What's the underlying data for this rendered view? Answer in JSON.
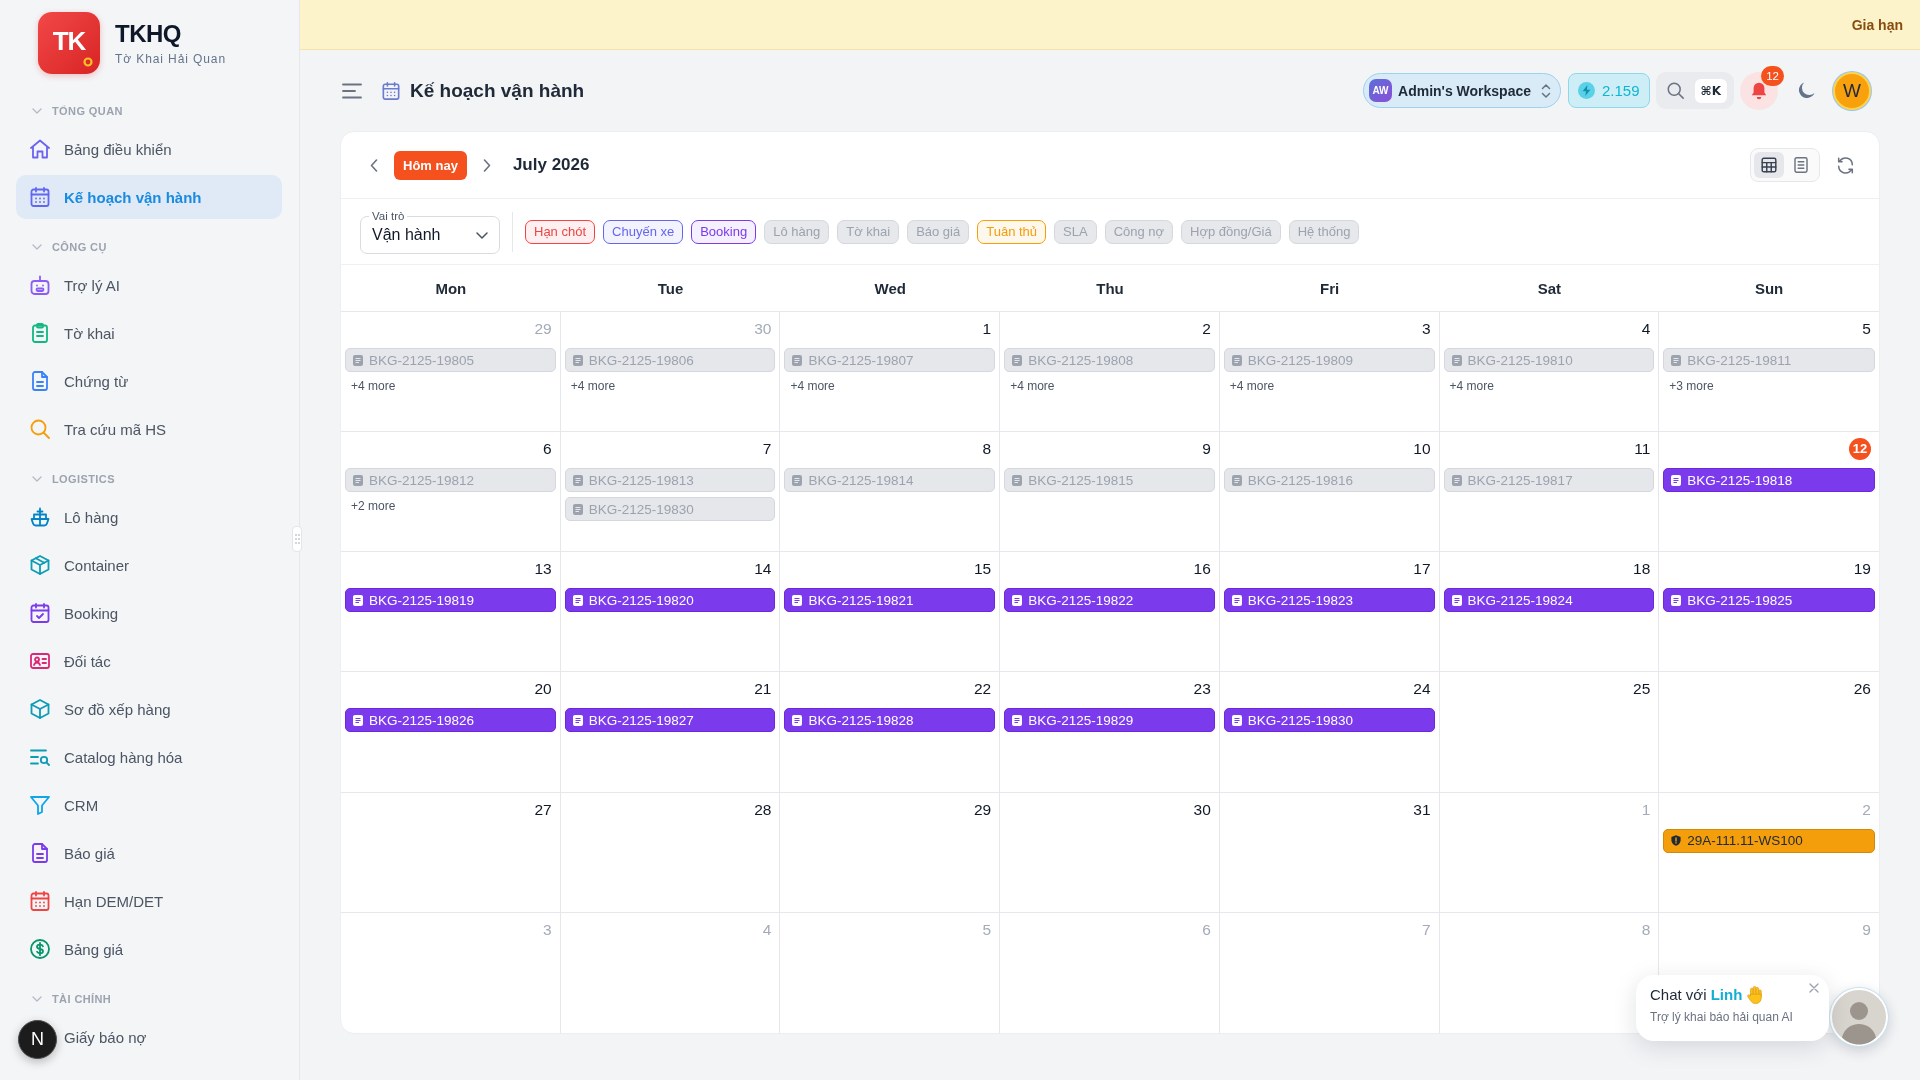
{
  "sidebar": {
    "logo": {
      "mark": "TK",
      "title": "TKHQ",
      "subtitle": "Tờ Khai Hải Quan"
    },
    "sections": [
      {
        "title": "TỔNG QUAN",
        "expanded": true,
        "items": [
          {
            "label": "Bảng điều khiển",
            "selected": false
          },
          {
            "label": "Kế hoạch vận hành",
            "selected": true
          }
        ]
      },
      {
        "title": "CÔNG CỤ",
        "expanded": true,
        "items": [
          {
            "label": "Trợ lý AI",
            "selected": false
          },
          {
            "label": "Tờ khai",
            "selected": false
          },
          {
            "label": "Chứng từ",
            "selected": false
          },
          {
            "label": "Tra cứu mã HS",
            "selected": false
          }
        ]
      },
      {
        "title": "LOGISTICS",
        "expanded": true,
        "items": [
          {
            "label": "Lô hàng",
            "selected": false
          },
          {
            "label": "Container",
            "selected": false
          },
          {
            "label": "Booking",
            "selected": false
          },
          {
            "label": "Đối tác",
            "selected": false
          },
          {
            "label": "Sơ đồ xếp hàng",
            "selected": false
          },
          {
            "label": "Catalog hàng hóa",
            "selected": false
          },
          {
            "label": "CRM",
            "selected": false
          },
          {
            "label": "Báo giá",
            "selected": false
          },
          {
            "label": "Hạn DEM/DET",
            "selected": false
          },
          {
            "label": "Bảng giá",
            "selected": false
          }
        ]
      },
      {
        "title": "TÀI CHÍNH",
        "expanded": true,
        "items": [
          {
            "label": "Giấy báo nợ",
            "selected": false
          }
        ]
      }
    ]
  },
  "banner": {
    "action": "Gia hạn"
  },
  "header": {
    "title": "Kế hoạch vận hành",
    "workspace": {
      "initials": "AW",
      "name": "Admin's Workspace"
    },
    "credits": "2.159",
    "search_shortcut": "⌘K",
    "notification_count": "12",
    "user_initial": "W"
  },
  "calendar": {
    "today_button": "Hôm nay",
    "month": "July 2026",
    "views": [
      {
        "kind": "month",
        "selected": true
      },
      {
        "kind": "list",
        "selected": false
      }
    ],
    "role": {
      "label": "Vai trò",
      "value": "Vận hành"
    },
    "filters": [
      {
        "label": "Hạn chót",
        "selected": true,
        "color": "#ef4444"
      },
      {
        "label": "Chuyến xe",
        "selected": true,
        "color": "#6366f1"
      },
      {
        "label": "Booking",
        "selected": true,
        "color": "#7c3aed"
      },
      {
        "label": "Lô hàng",
        "selected": false
      },
      {
        "label": "Tờ khai",
        "selected": false
      },
      {
        "label": "Báo giá",
        "selected": false
      },
      {
        "label": "Tuân thủ",
        "selected": true,
        "color": "#f59e0b"
      },
      {
        "label": "SLA",
        "selected": false
      },
      {
        "label": "Công nợ",
        "selected": false
      },
      {
        "label": "Hợp đồng/Giá",
        "selected": false
      },
      {
        "label": "Hệ thống",
        "selected": false
      }
    ],
    "weekdays": [
      "Mon",
      "Tue",
      "Wed",
      "Thu",
      "Fri",
      "Sat",
      "Sun"
    ],
    "weeks": [
      {
        "days": [
          {
            "date": "29",
            "outside": true,
            "today": false,
            "events": [
              {
                "label": "BKG-2125-19805",
                "kind": "booking",
                "past": true
              }
            ],
            "more": "+4 more"
          },
          {
            "date": "30",
            "outside": true,
            "today": false,
            "events": [
              {
                "label": "BKG-2125-19806",
                "kind": "booking",
                "past": true
              }
            ],
            "more": "+4 more"
          },
          {
            "date": "1",
            "outside": false,
            "today": false,
            "events": [
              {
                "label": "BKG-2125-19807",
                "kind": "booking",
                "past": true
              }
            ],
            "more": "+4 more"
          },
          {
            "date": "2",
            "outside": false,
            "today": false,
            "events": [
              {
                "label": "BKG-2125-19808",
                "kind": "booking",
                "past": true
              }
            ],
            "more": "+4 more"
          },
          {
            "date": "3",
            "outside": false,
            "today": false,
            "events": [
              {
                "label": "BKG-2125-19809",
                "kind": "booking",
                "past": true
              }
            ],
            "more": "+4 more"
          },
          {
            "date": "4",
            "outside": false,
            "today": false,
            "events": [
              {
                "label": "BKG-2125-19810",
                "kind": "booking",
                "past": true
              }
            ],
            "more": "+4 more"
          },
          {
            "date": "5",
            "outside": false,
            "today": false,
            "events": [
              {
                "label": "BKG-2125-19811",
                "kind": "booking",
                "past": true
              }
            ],
            "more": "+3 more"
          }
        ]
      },
      {
        "days": [
          {
            "date": "6",
            "outside": false,
            "today": false,
            "events": [
              {
                "label": "BKG-2125-19812",
                "kind": "booking",
                "past": true
              }
            ],
            "more": "+2 more"
          },
          {
            "date": "7",
            "outside": false,
            "today": false,
            "events": [
              {
                "label": "BKG-2125-19813",
                "kind": "booking",
                "past": true
              },
              {
                "label": "BKG-2125-19830",
                "kind": "booking",
                "past": true
              }
            ]
          },
          {
            "date": "8",
            "outside": false,
            "today": false,
            "events": [
              {
                "label": "BKG-2125-19814",
                "kind": "booking",
                "past": true
              }
            ]
          },
          {
            "date": "9",
            "outside": false,
            "today": false,
            "events": [
              {
                "label": "BKG-2125-19815",
                "kind": "booking",
                "past": true
              }
            ]
          },
          {
            "date": "10",
            "outside": false,
            "today": false,
            "events": [
              {
                "label": "BKG-2125-19816",
                "kind": "booking",
                "past": true
              }
            ]
          },
          {
            "date": "11",
            "outside": false,
            "today": false,
            "events": [
              {
                "label": "BKG-2125-19817",
                "kind": "booking",
                "past": true
              }
            ]
          },
          {
            "date": "12",
            "outside": false,
            "today": true,
            "events": [
              {
                "label": "BKG-2125-19818",
                "kind": "booking",
                "past": false
              }
            ]
          }
        ]
      },
      {
        "days": [
          {
            "date": "13",
            "outside": false,
            "today": false,
            "events": [
              {
                "label": "BKG-2125-19819",
                "kind": "booking",
                "past": false
              }
            ]
          },
          {
            "date": "14",
            "outside": false,
            "today": false,
            "events": [
              {
                "label": "BKG-2125-19820",
                "kind": "booking",
                "past": false
              }
            ]
          },
          {
            "date": "15",
            "outside": false,
            "today": false,
            "events": [
              {
                "label": "BKG-2125-19821",
                "kind": "booking",
                "past": false
              }
            ]
          },
          {
            "date": "16",
            "outside": false,
            "today": false,
            "events": [
              {
                "label": "BKG-2125-19822",
                "kind": "booking",
                "past": false
              }
            ]
          },
          {
            "date": "17",
            "outside": false,
            "today": false,
            "events": [
              {
                "label": "BKG-2125-19823",
                "kind": "booking",
                "past": false
              }
            ]
          },
          {
            "date": "18",
            "outside": false,
            "today": false,
            "events": [
              {
                "label": "BKG-2125-19824",
                "kind": "booking",
                "past": false
              }
            ]
          },
          {
            "date": "19",
            "outside": false,
            "today": false,
            "events": [
              {
                "label": "BKG-2125-19825",
                "kind": "booking",
                "past": false
              }
            ]
          }
        ]
      },
      {
        "days": [
          {
            "date": "20",
            "outside": false,
            "today": false,
            "events": [
              {
                "label": "BKG-2125-19826",
                "kind": "booking",
                "past": false
              }
            ]
          },
          {
            "date": "21",
            "outside": false,
            "today": false,
            "events": [
              {
                "label": "BKG-2125-19827",
                "kind": "booking",
                "past": false
              }
            ]
          },
          {
            "date": "22",
            "outside": false,
            "today": false,
            "events": [
              {
                "label": "BKG-2125-19828",
                "kind": "booking",
                "past": false
              }
            ]
          },
          {
            "date": "23",
            "outside": false,
            "today": false,
            "events": [
              {
                "label": "BKG-2125-19829",
                "kind": "booking",
                "past": false
              }
            ]
          },
          {
            "date": "24",
            "outside": false,
            "today": false,
            "events": [
              {
                "label": "BKG-2125-19830",
                "kind": "booking",
                "past": false
              }
            ]
          },
          {
            "date": "25",
            "outside": false,
            "today": false
          },
          {
            "date": "26",
            "outside": false,
            "today": false
          }
        ]
      },
      {
        "days": [
          {
            "date": "27",
            "outside": false,
            "today": false
          },
          {
            "date": "28",
            "outside": false,
            "today": false
          },
          {
            "date": "29",
            "outside": false,
            "today": false
          },
          {
            "date": "30",
            "outside": false,
            "today": false
          },
          {
            "date": "31",
            "outside": false,
            "today": false
          },
          {
            "date": "1",
            "outside": true,
            "today": false
          },
          {
            "date": "2",
            "outside": true,
            "today": false,
            "events": [
              {
                "label": "29A-111.11-WS100",
                "kind": "compliance",
                "past": false
              }
            ]
          }
        ]
      },
      {
        "days": [
          {
            "date": "3",
            "outside": true,
            "today": false
          },
          {
            "date": "4",
            "outside": true,
            "today": false
          },
          {
            "date": "5",
            "outside": true,
            "today": false
          },
          {
            "date": "6",
            "outside": true,
            "today": false
          },
          {
            "date": "7",
            "outside": true,
            "today": false
          },
          {
            "date": "8",
            "outside": true,
            "today": false
          },
          {
            "date": "9",
            "outside": true,
            "today": false
          }
        ]
      }
    ]
  },
  "chat": {
    "title": "Chat với **Linh**",
    "subtitle": "Trợ lý khai báo hải quan AI"
  },
  "dev_badge": {
    "label": "N"
  }
}
